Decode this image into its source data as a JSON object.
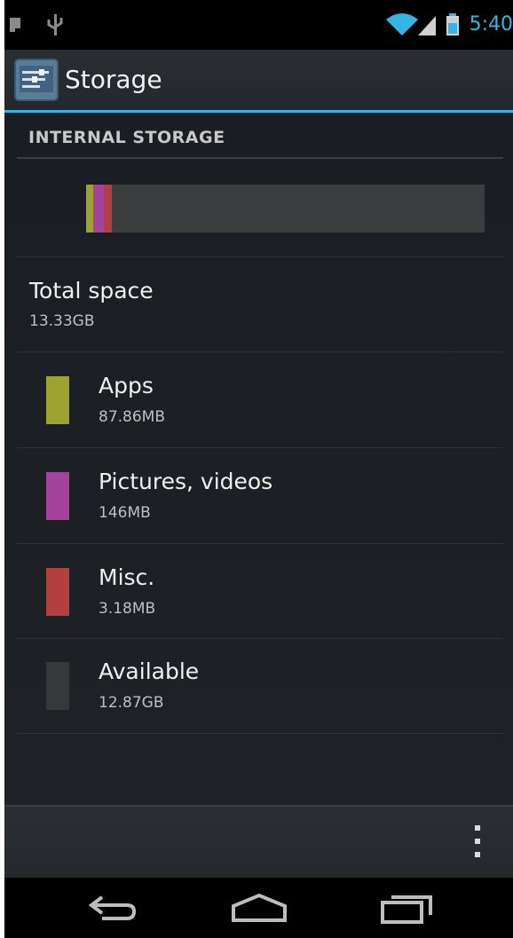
{
  "status_bar": {
    "time": "5:40",
    "icons": [
      "android-debug-icon",
      "usb-icon",
      "wifi-icon",
      "signal-icon",
      "battery-icon"
    ],
    "accent_color": "#33b5e5"
  },
  "action_bar": {
    "title": "Storage",
    "icon": "storage-settings-icon"
  },
  "section": {
    "header": "INTERNAL STORAGE"
  },
  "usage_bar": {
    "segments": [
      {
        "name": "apps",
        "fraction": 0.017,
        "color": "#9da332"
      },
      {
        "name": "pictures",
        "fraction": 0.028,
        "color": "#a3449a"
      },
      {
        "name": "misc",
        "fraction": 0.02,
        "color": "#b2403f"
      },
      {
        "name": "available",
        "fraction": 0.935,
        "color": "#3b3d3f"
      }
    ]
  },
  "total": {
    "label": "Total space",
    "value": "13.33GB"
  },
  "items": [
    {
      "label": "Apps",
      "value": "87.86MB",
      "color": "#9da332"
    },
    {
      "label": "Pictures, videos",
      "value": "146MB",
      "color": "#a3449a"
    },
    {
      "label": "Misc.",
      "value": "3.18MB",
      "color": "#b2403f"
    },
    {
      "label": "Available",
      "value": "12.87GB",
      "color": "#363839"
    }
  ],
  "bottom_bar": {
    "menu_icon": "overflow-menu-icon"
  },
  "nav_bar": {
    "buttons": [
      "back-icon",
      "home-icon",
      "recent-apps-icon"
    ]
  }
}
